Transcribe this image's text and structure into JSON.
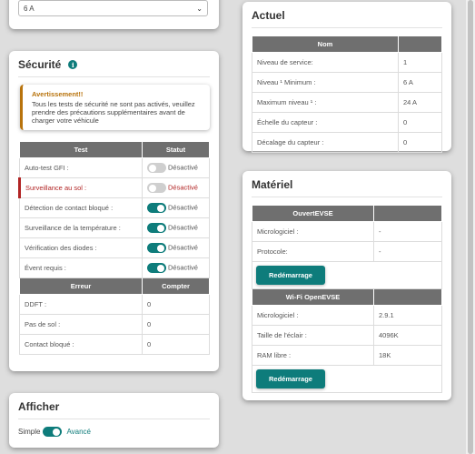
{
  "rate_select": {
    "value": "6 A"
  },
  "securite": {
    "title": "Sécurité",
    "info_icon": "i",
    "warning": {
      "title": "Avertissement!!",
      "text": "Tous les tests de sécurité ne sont pas activés, veuillez prendre des précautions supplémentaires avant de charger votre véhicule"
    },
    "tests_headers": [
      "Test",
      "Statut"
    ],
    "tests": [
      {
        "label": "Auto-test GFI :",
        "status": "Désactivé",
        "on": false,
        "alert": false
      },
      {
        "label": "Surveillance au sol :",
        "status": "Désactivé",
        "on": false,
        "alert": true
      },
      {
        "label": "Détection de contact bloqué :",
        "status": "Désactivé",
        "on": true,
        "alert": false
      },
      {
        "label": "Surveillance de la température :",
        "status": "Désactivé",
        "on": true,
        "alert": false
      },
      {
        "label": "Vérification des diodes :",
        "status": "Désactivé",
        "on": true,
        "alert": false
      },
      {
        "label": "Évent requis :",
        "status": "Désactivé",
        "on": true,
        "alert": false
      }
    ],
    "errors_headers": [
      "Erreur",
      "Compter"
    ],
    "errors": [
      {
        "label": "DDFT :",
        "value": "0"
      },
      {
        "label": "Pas de sol :",
        "value": "0"
      },
      {
        "label": "Contact bloqué :",
        "value": "0"
      }
    ]
  },
  "afficher": {
    "title": "Afficher",
    "simple_label": "Simple",
    "advanced_label": "Avancé",
    "accent": "#0e7c7b"
  },
  "actuel": {
    "title": "Actuel",
    "header": "Nom",
    "rows": [
      {
        "label": "Niveau de service:",
        "value": "1"
      },
      {
        "label": "Niveau ¹ Minimum :",
        "value": "6 A"
      },
      {
        "label": "Maximum niveau ¹ :",
        "value": "24 A"
      },
      {
        "label": "Échelle du capteur :",
        "value": "0"
      },
      {
        "label": "Décalage du capteur :",
        "value": "0"
      }
    ]
  },
  "materiel": {
    "title": "Matériel",
    "evse_header": "OuvertEVSE",
    "evse_rows": [
      {
        "label": "Micrologiciel :",
        "value": "-"
      },
      {
        "label": "Protocole:",
        "value": "-"
      }
    ],
    "wifi_header": "Wi-Fi OpenEVSE",
    "wifi_rows": [
      {
        "label": "Micrologiciel :",
        "value": "2.9.1"
      },
      {
        "label": "Taille de l'éclair :",
        "value": "4096K"
      },
      {
        "label": "RAM libre :",
        "value": "18K"
      }
    ],
    "restart_label": "Redémarrage"
  }
}
